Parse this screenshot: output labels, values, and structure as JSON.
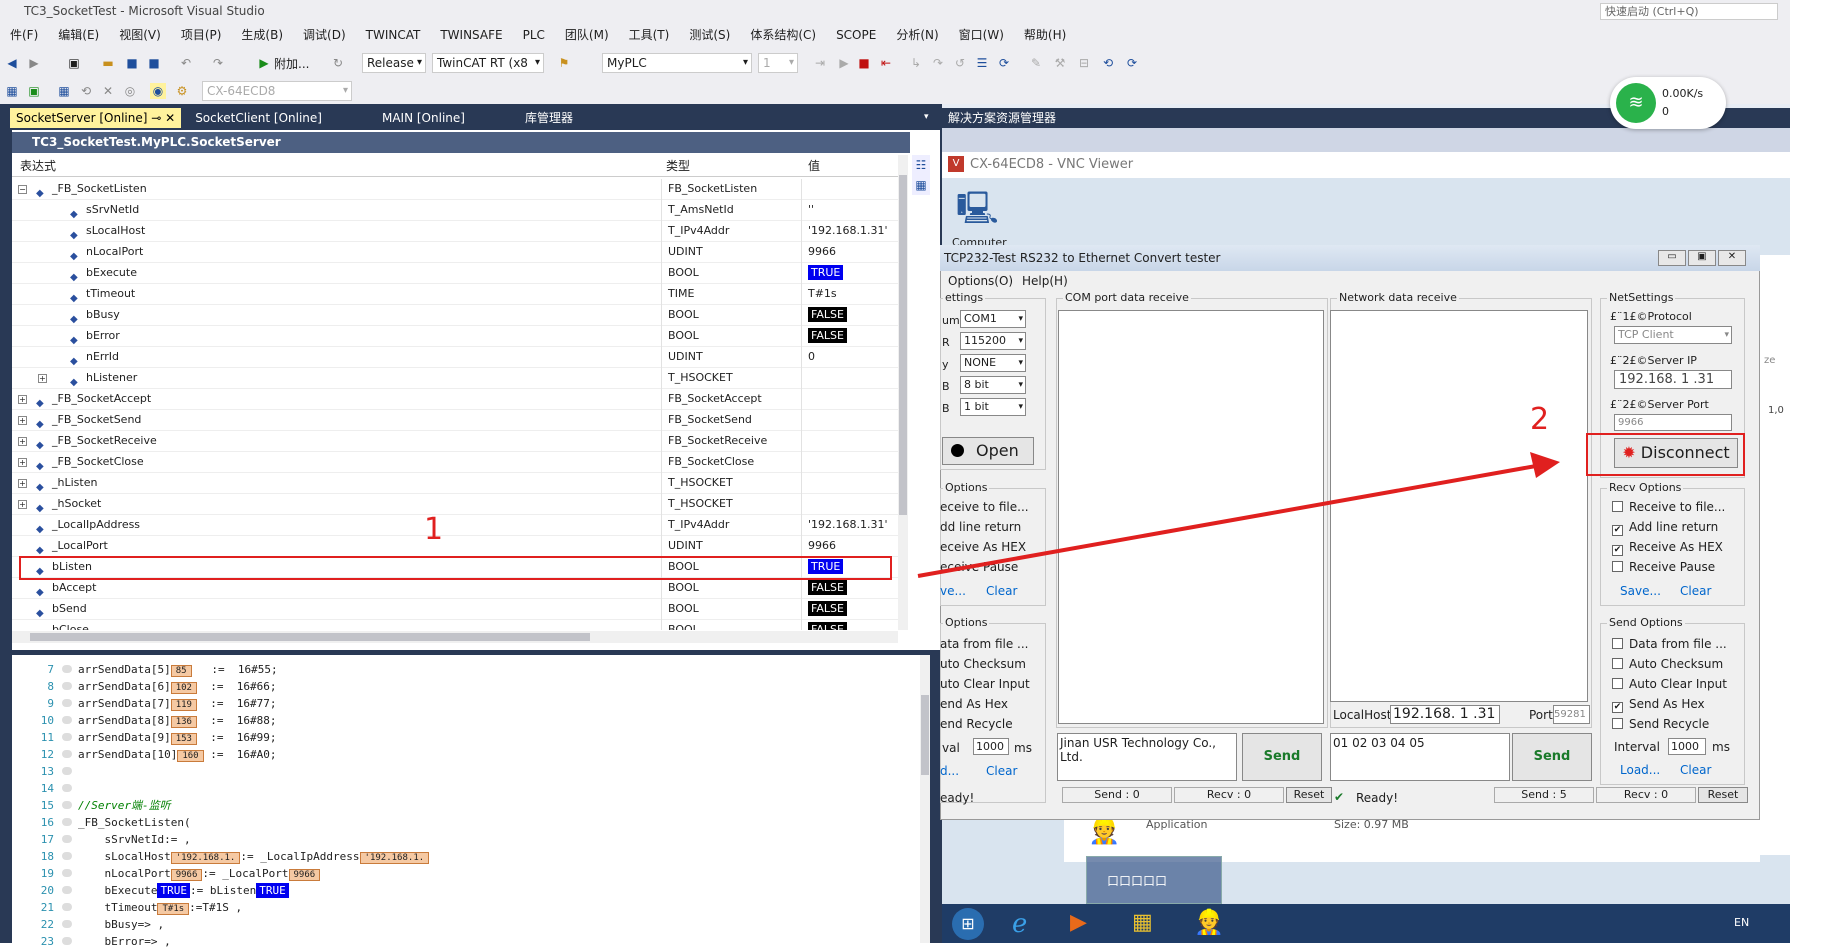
{
  "window": {
    "title": "TC3_SocketTest - Microsoft Visual Studio",
    "quick_launch": "快速启动 (Ctrl+Q)"
  },
  "menu": [
    "件(F)",
    "编辑(E)",
    "视图(V)",
    "项目(P)",
    "生成(B)",
    "调试(D)",
    "TWINCAT",
    "TWINSAFE",
    "PLC",
    "团队(M)",
    "工具(T)",
    "测试(S)",
    "体系结构(C)",
    "SCOPE",
    "分析(N)",
    "窗口(W)",
    "帮助(H)"
  ],
  "toolbar": {
    "attach": "附加...",
    "config": "Release",
    "platform": "TwinCAT RT (x8",
    "plc": "MyPLC",
    "num": "1",
    "target": "CX-64ECD8"
  },
  "tabs": [
    "SocketServer [Online]",
    "SocketClient [Online]",
    "MAIN [Online]",
    "库管理器"
  ],
  "panel": {
    "title": "TC3_SocketTest.MyPLC.SocketServer",
    "col_expr": "表达式",
    "col_type": "类型",
    "col_val": "值"
  },
  "rows": [
    {
      "name": "_FB_SocketListen",
      "type": "FB_SocketListen",
      "value": "",
      "indent": 0,
      "exp": "−",
      "vstyle": ""
    },
    {
      "name": "sSrvNetId",
      "type": "T_AmsNetId",
      "value": "''",
      "indent": 1,
      "exp": "",
      "vstyle": ""
    },
    {
      "name": "sLocalHost",
      "type": "T_IPv4Addr",
      "value": "'192.168.1.31'",
      "indent": 1,
      "exp": "",
      "vstyle": ""
    },
    {
      "name": "nLocalPort",
      "type": "UDINT",
      "value": "9966",
      "indent": 1,
      "exp": "",
      "vstyle": ""
    },
    {
      "name": "bExecute",
      "type": "BOOL",
      "value": "TRUE",
      "indent": 1,
      "exp": "",
      "vstyle": "blue"
    },
    {
      "name": "tTimeout",
      "type": "TIME",
      "value": "T#1s",
      "indent": 1,
      "exp": "",
      "vstyle": ""
    },
    {
      "name": "bBusy",
      "type": "BOOL",
      "value": "FALSE",
      "indent": 1,
      "exp": "",
      "vstyle": "black"
    },
    {
      "name": "bError",
      "type": "BOOL",
      "value": "FALSE",
      "indent": 1,
      "exp": "",
      "vstyle": "black"
    },
    {
      "name": "nErrId",
      "type": "UDINT",
      "value": "0",
      "indent": 1,
      "exp": "",
      "vstyle": ""
    },
    {
      "name": "hListener",
      "type": "T_HSOCKET",
      "value": "",
      "indent": 1,
      "exp": "+",
      "vstyle": ""
    },
    {
      "name": "_FB_SocketAccept",
      "type": "FB_SocketAccept",
      "value": "",
      "indent": 0,
      "exp": "+",
      "vstyle": ""
    },
    {
      "name": "_FB_SocketSend",
      "type": "FB_SocketSend",
      "value": "",
      "indent": 0,
      "exp": "+",
      "vstyle": ""
    },
    {
      "name": "_FB_SocketReceive",
      "type": "FB_SocketReceive",
      "value": "",
      "indent": 0,
      "exp": "+",
      "vstyle": ""
    },
    {
      "name": "_FB_SocketClose",
      "type": "FB_SocketClose",
      "value": "",
      "indent": 0,
      "exp": "+",
      "vstyle": ""
    },
    {
      "name": "_hListen",
      "type": "T_HSOCKET",
      "value": "",
      "indent": 0,
      "exp": "+",
      "vstyle": ""
    },
    {
      "name": "_hSocket",
      "type": "T_HSOCKET",
      "value": "",
      "indent": 0,
      "exp": "+",
      "vstyle": ""
    },
    {
      "name": "_LocalIpAddress",
      "type": "T_IPv4Addr",
      "value": "'192.168.1.31'",
      "indent": 0,
      "exp": "",
      "vstyle": ""
    },
    {
      "name": "_LocalPort",
      "type": "UDINT",
      "value": "9966",
      "indent": 0,
      "exp": "",
      "vstyle": ""
    },
    {
      "name": "bListen",
      "type": "BOOL",
      "value": "TRUE",
      "indent": 0,
      "exp": "",
      "vstyle": "blue"
    },
    {
      "name": "bAccept",
      "type": "BOOL",
      "value": "FALSE",
      "indent": 0,
      "exp": "",
      "vstyle": "black"
    },
    {
      "name": "bSend",
      "type": "BOOL",
      "value": "FALSE",
      "indent": 0,
      "exp": "",
      "vstyle": "black"
    },
    {
      "name": "bClose",
      "type": "BOOL",
      "value": "FALSE",
      "indent": 0,
      "exp": "",
      "vstyle": "black"
    }
  ],
  "code": [
    {
      "n": "7",
      "t": "arrSendData[5]",
      "b": "85",
      "r": "   :=  16#55;"
    },
    {
      "n": "8",
      "t": "arrSendData[6]",
      "b": "102",
      "r": "  :=  16#66;"
    },
    {
      "n": "9",
      "t": "arrSendData[7]",
      "b": "119",
      "r": "  :=  16#77;"
    },
    {
      "n": "10",
      "t": "arrSendData[8]",
      "b": "136",
      "r": "  :=  16#88;"
    },
    {
      "n": "11",
      "t": "arrSendData[9]",
      "b": "153",
      "r": "  :=  16#99;"
    },
    {
      "n": "12",
      "t": "arrSendData[10]",
      "b": "160",
      "r": " :=  16#A0;"
    },
    {
      "n": "13",
      "t": "",
      "b": "",
      "r": ""
    },
    {
      "n": "14",
      "t": "",
      "b": "",
      "r": ""
    },
    {
      "n": "15",
      "t": "//Server端-监听",
      "b": "",
      "r": "",
      "cm": true
    },
    {
      "n": "16",
      "t": "_FB_SocketListen(",
      "b": "",
      "r": ""
    },
    {
      "n": "17",
      "t": "    sSrvNetId:= ,",
      "b": "",
      "r": ""
    },
    {
      "n": "18",
      "t": "    sLocalHost",
      "b": "'192.168.1.",
      "r": ":= _LocalIpAddress",
      "b2": "'192.168.1."
    },
    {
      "n": "19",
      "t": "    nLocalPort",
      "b": "9966",
      "r": ":= _LocalPort",
      "b2": "9966"
    },
    {
      "n": "20",
      "t": "    bExecute",
      "bb": "TRUE",
      "r": ":= bListen",
      "bb2": "TRUE"
    },
    {
      "n": "21",
      "t": "    tTimeout",
      "b": "T#1s",
      "r": ":=T#1S ,"
    },
    {
      "n": "22",
      "t": "    bBusy=> ,",
      "b": "",
      "r": ""
    },
    {
      "n": "23",
      "t": "    bError=> ,",
      "b": "",
      "r": ""
    }
  ],
  "solution_title": "解决方案资源管理器",
  "vnc": {
    "title": "CX-64ECD8 - VNC Viewer",
    "desktop_icon": "Computer"
  },
  "tester": {
    "title": "TCP232-Test  RS232 to Ethernet Convert tester",
    "menu": [
      "Options(O)",
      "Help(H)"
    ],
    "settings_title": "ettings",
    "port_labels": [
      "um",
      "R",
      "y",
      "B",
      "B"
    ],
    "port_values": [
      "COM1",
      "115200",
      "NONE",
      "8 bit",
      "1 bit"
    ],
    "open_btn": "Open",
    "recv_left_title": "Options",
    "recv_left": [
      "eceive to file...",
      "dd line return",
      "eceive As HEX",
      "eceive Pause"
    ],
    "recv_left_links": [
      "ve...",
      "Clear"
    ],
    "send_left_title": "Options",
    "send_left": [
      "ata from file ...",
      "uto Checksum",
      "uto Clear Input",
      "end As Hex",
      "end Recycle"
    ],
    "send_left_interval_label": "val",
    "send_left_interval": "1000",
    "ms": "ms",
    "send_left_links": [
      "d...",
      "Clear"
    ],
    "com_recv_title": "COM port data receive",
    "net_recv_title": "Network data receive",
    "localhost_label": "LocalHost",
    "localhost": "192.168. 1 .31",
    "port_label": "Port",
    "port": "59281",
    "com_input": "Jinan USR Technology Co., Ltd.",
    "net_input": "01 02 03 04 05",
    "send": "Send",
    "net_title": "NetSettings",
    "protocol_label": "£¨1£©Protocol",
    "protocol": "TCP Client",
    "server_ip_label": "£¨2£©Server IP",
    "server_ip": "192.168. 1 .31",
    "server_port_label": "£¨2£©Server Port",
    "server_port": "9966",
    "disconnect": "Disconnect",
    "recv_title": "Recv Options",
    "recv_opts": [
      {
        "l": "Receive to file...",
        "c": false
      },
      {
        "l": "Add line return",
        "c": true
      },
      {
        "l": "Receive As HEX",
        "c": true
      },
      {
        "l": "Receive Pause",
        "c": false
      }
    ],
    "recv_links": [
      "Save...",
      "Clear"
    ],
    "send_title": "Send Options",
    "send_opts": [
      {
        "l": "Data from file ...",
        "c": false
      },
      {
        "l": "Auto Checksum",
        "c": false
      },
      {
        "l": "Auto Clear Input",
        "c": false
      },
      {
        "l": "Send As Hex",
        "c": true
      },
      {
        "l": "Send Recycle",
        "c": false
      }
    ],
    "interval_label": "Interval",
    "interval": "1000",
    "send_links": [
      "Load...",
      "Clear"
    ],
    "status_left": "eady!",
    "status_mid": "Ready!",
    "send0": "Send : 0",
    "recv0": "Recv : 0",
    "reset": "Reset",
    "send5": "Send : 5",
    "recv0b": "Recv : 0"
  },
  "behind": {
    "application": "Application",
    "size": "Size: 0.97 MB",
    "ze": "ze",
    "one": "1,0"
  },
  "taskbar": {
    "task": "口口口口口",
    "lang": "EN"
  },
  "wifi": {
    "speed": "0.00K/s",
    "count": "0"
  },
  "annotations": {
    "one": "1",
    "two": "2"
  }
}
